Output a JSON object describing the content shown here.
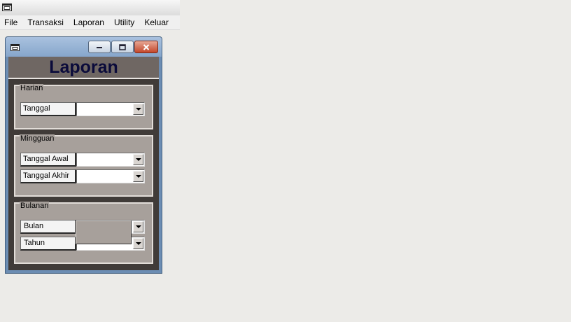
{
  "menubar": {
    "items": [
      "File",
      "Transaksi",
      "Laporan",
      "Utility",
      "Keluar"
    ]
  },
  "form": {
    "heading": "Laporan",
    "harian": {
      "legend": "Harian",
      "tanggal_label": "Tanggal",
      "tanggal_value": ""
    },
    "mingguan": {
      "legend": "Mingguan",
      "tanggal_awal_label": "Tanggal Awal",
      "tanggal_awal_value": "",
      "tanggal_akhir_label": "Tanggal Akhir",
      "tanggal_akhir_value": ""
    },
    "bulanan": {
      "legend": "Bulanan",
      "bulan_label": "Bulan",
      "bulan_value": "",
      "tahun_label": "Tahun",
      "tahun_value": ""
    }
  },
  "icons": {
    "app": "window-icon",
    "child": "window-icon",
    "minimize": "minimize-icon",
    "maximize": "maximize-icon",
    "close": "close-icon",
    "dropdown": "chevron-down-icon"
  },
  "colors": {
    "header_bg": "#6f6763",
    "heading_text": "#0b0b3a",
    "frame_bg": "#a7a09b",
    "close_button": "#c4472b"
  }
}
